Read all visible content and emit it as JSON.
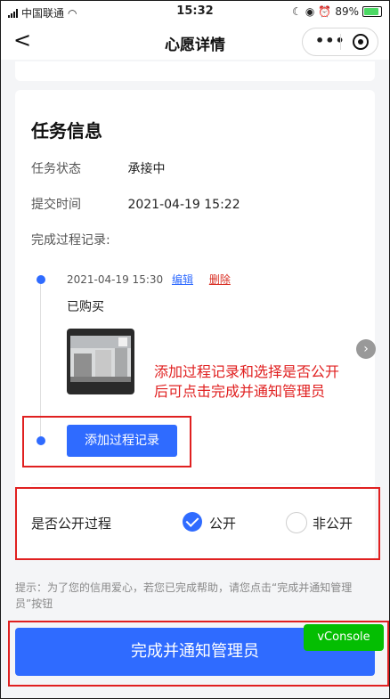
{
  "status_bar": {
    "carrier": "中国联通",
    "time": "15:32",
    "battery": "89%"
  },
  "nav": {
    "title": "心愿详情"
  },
  "task": {
    "heading": "任务信息",
    "status_label": "任务状态",
    "status_value": "承接中",
    "submit_label": "提交时间",
    "submit_value": "2021-04-19 15:22",
    "process_label": "完成过程记录:"
  },
  "record": {
    "timestamp": "2021-04-19 15:30",
    "edit": "编辑",
    "delete": "删除",
    "text": "已购买"
  },
  "annotation": {
    "line1": "添加过程记录和选择是否公开",
    "line2": "后可点击完成并通知管理员"
  },
  "add_record_button": "添加过程记录",
  "visibility": {
    "label": "是否公开过程",
    "public": "公开",
    "private": "非公开",
    "selected": "公开"
  },
  "tip": "提示：为了您的信用爱心，若您已完成帮助，请您点击“完成并通知管理员”按钮",
  "submit_button": "完成并通知管理员",
  "vconsole": "vConsole",
  "colors": {
    "primary": "#2f6bff",
    "annotation_red": "#e02020",
    "vconsole_green": "#04be02"
  }
}
